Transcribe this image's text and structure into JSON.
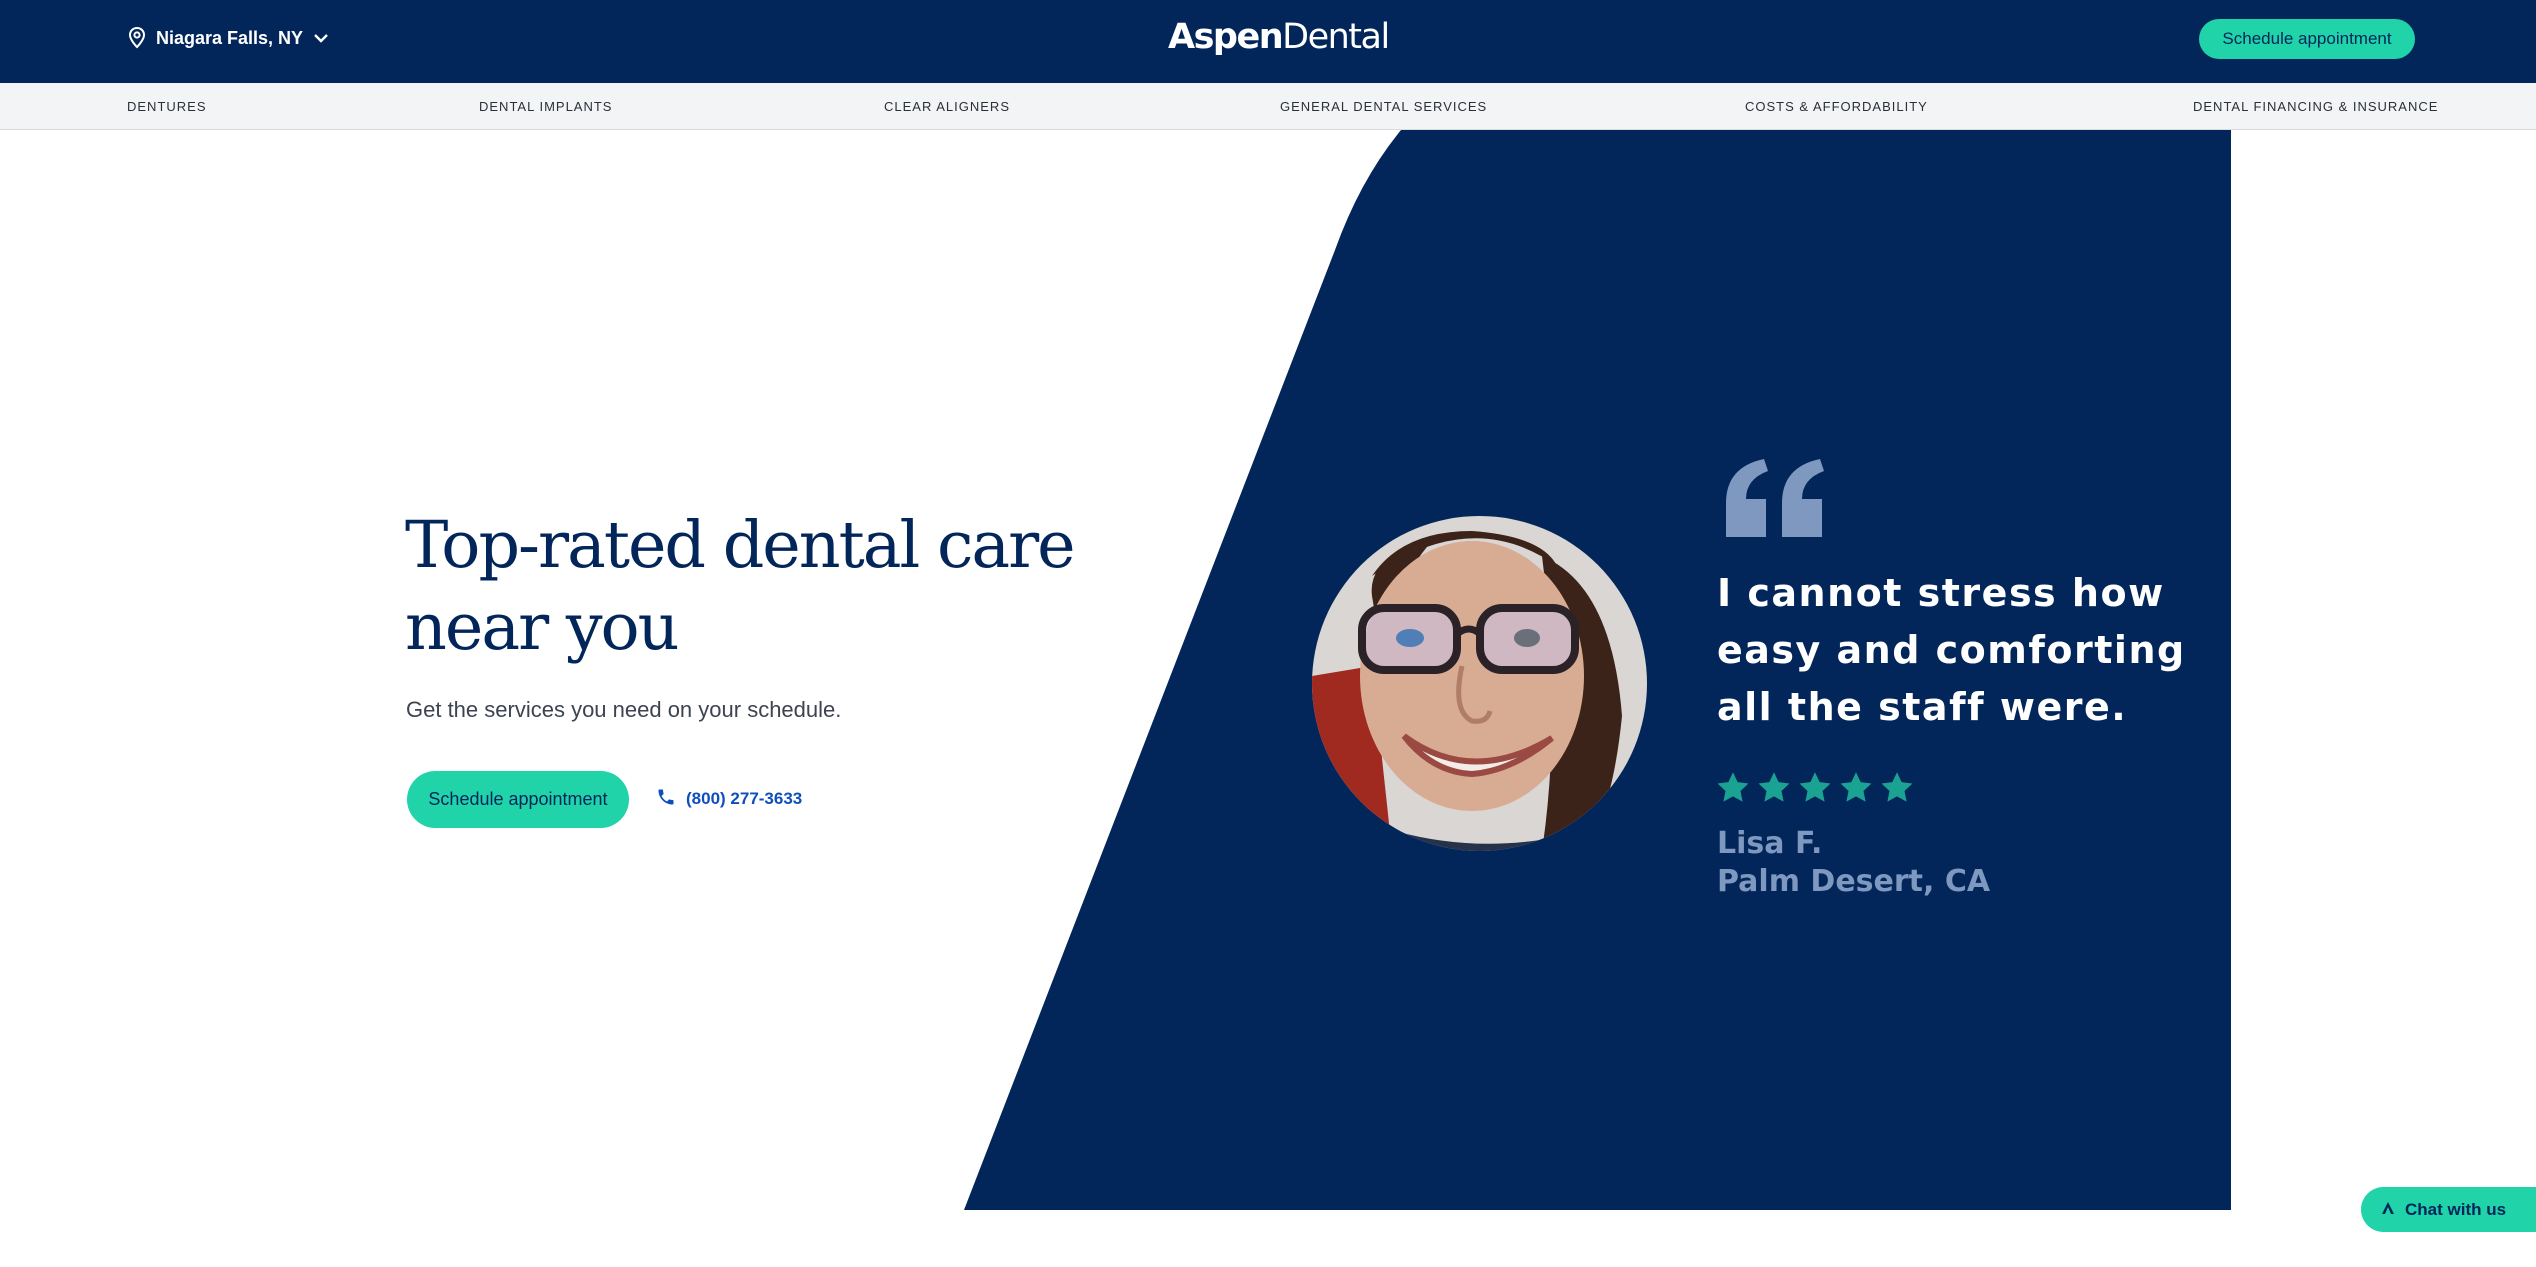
{
  "header": {
    "location": "Niagara Falls, NY",
    "logo": {
      "part1": "Aspen",
      "part2": "Dental"
    },
    "cta": "Schedule appointment"
  },
  "nav": {
    "items": [
      "DENTURES",
      "DENTAL IMPLANTS",
      "CLEAR ALIGNERS",
      "GENERAL DENTAL SERVICES",
      "COSTS & AFFORDABILITY",
      "DENTAL FINANCING & INSURANCE"
    ]
  },
  "hero": {
    "title": "Top-rated dental care near you",
    "subtitle": "Get the services you need on your schedule.",
    "cta": "Schedule appointment",
    "phone": "(800) 277-3633"
  },
  "testimonial": {
    "quote": "I cannot stress how easy and comforting all the staff were.",
    "rating": 5,
    "name": "Lisa F.",
    "place": "Palm Desert, CA"
  },
  "chat": {
    "label": "Chat with us"
  },
  "colors": {
    "navy": "#02265a",
    "mint": "#21d3a9",
    "star": "#1aa392",
    "quote_mark": "#7f98c0",
    "phone_link": "#0f4fbd"
  }
}
